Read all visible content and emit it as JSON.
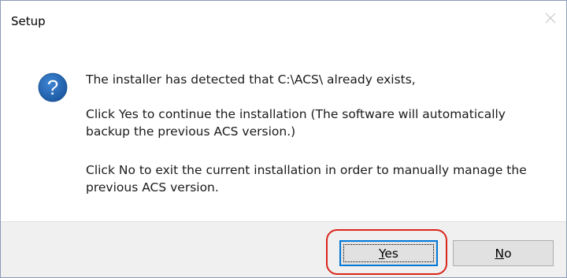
{
  "window": {
    "title": "Setup",
    "close_icon": "close-icon"
  },
  "message": {
    "icon": "question-icon",
    "line1": "The installer has detected that C:\\ACS\\ already exists,",
    "line2a": "Click Yes to continue the installation (The software will automatically",
    "line2b": "backup the previous ACS version.)",
    "line3a": "Click No to exit the current installation in order to manually manage the",
    "line3b": "previous ACS version."
  },
  "buttons": {
    "yes": {
      "mnemonic": "Y",
      "rest": "es"
    },
    "no": {
      "mnemonic": "N",
      "rest": "o"
    }
  },
  "colors": {
    "icon_blue": "#1f5fa8",
    "highlight_ring": "#d9261c",
    "focus_border": "#0078d7"
  }
}
